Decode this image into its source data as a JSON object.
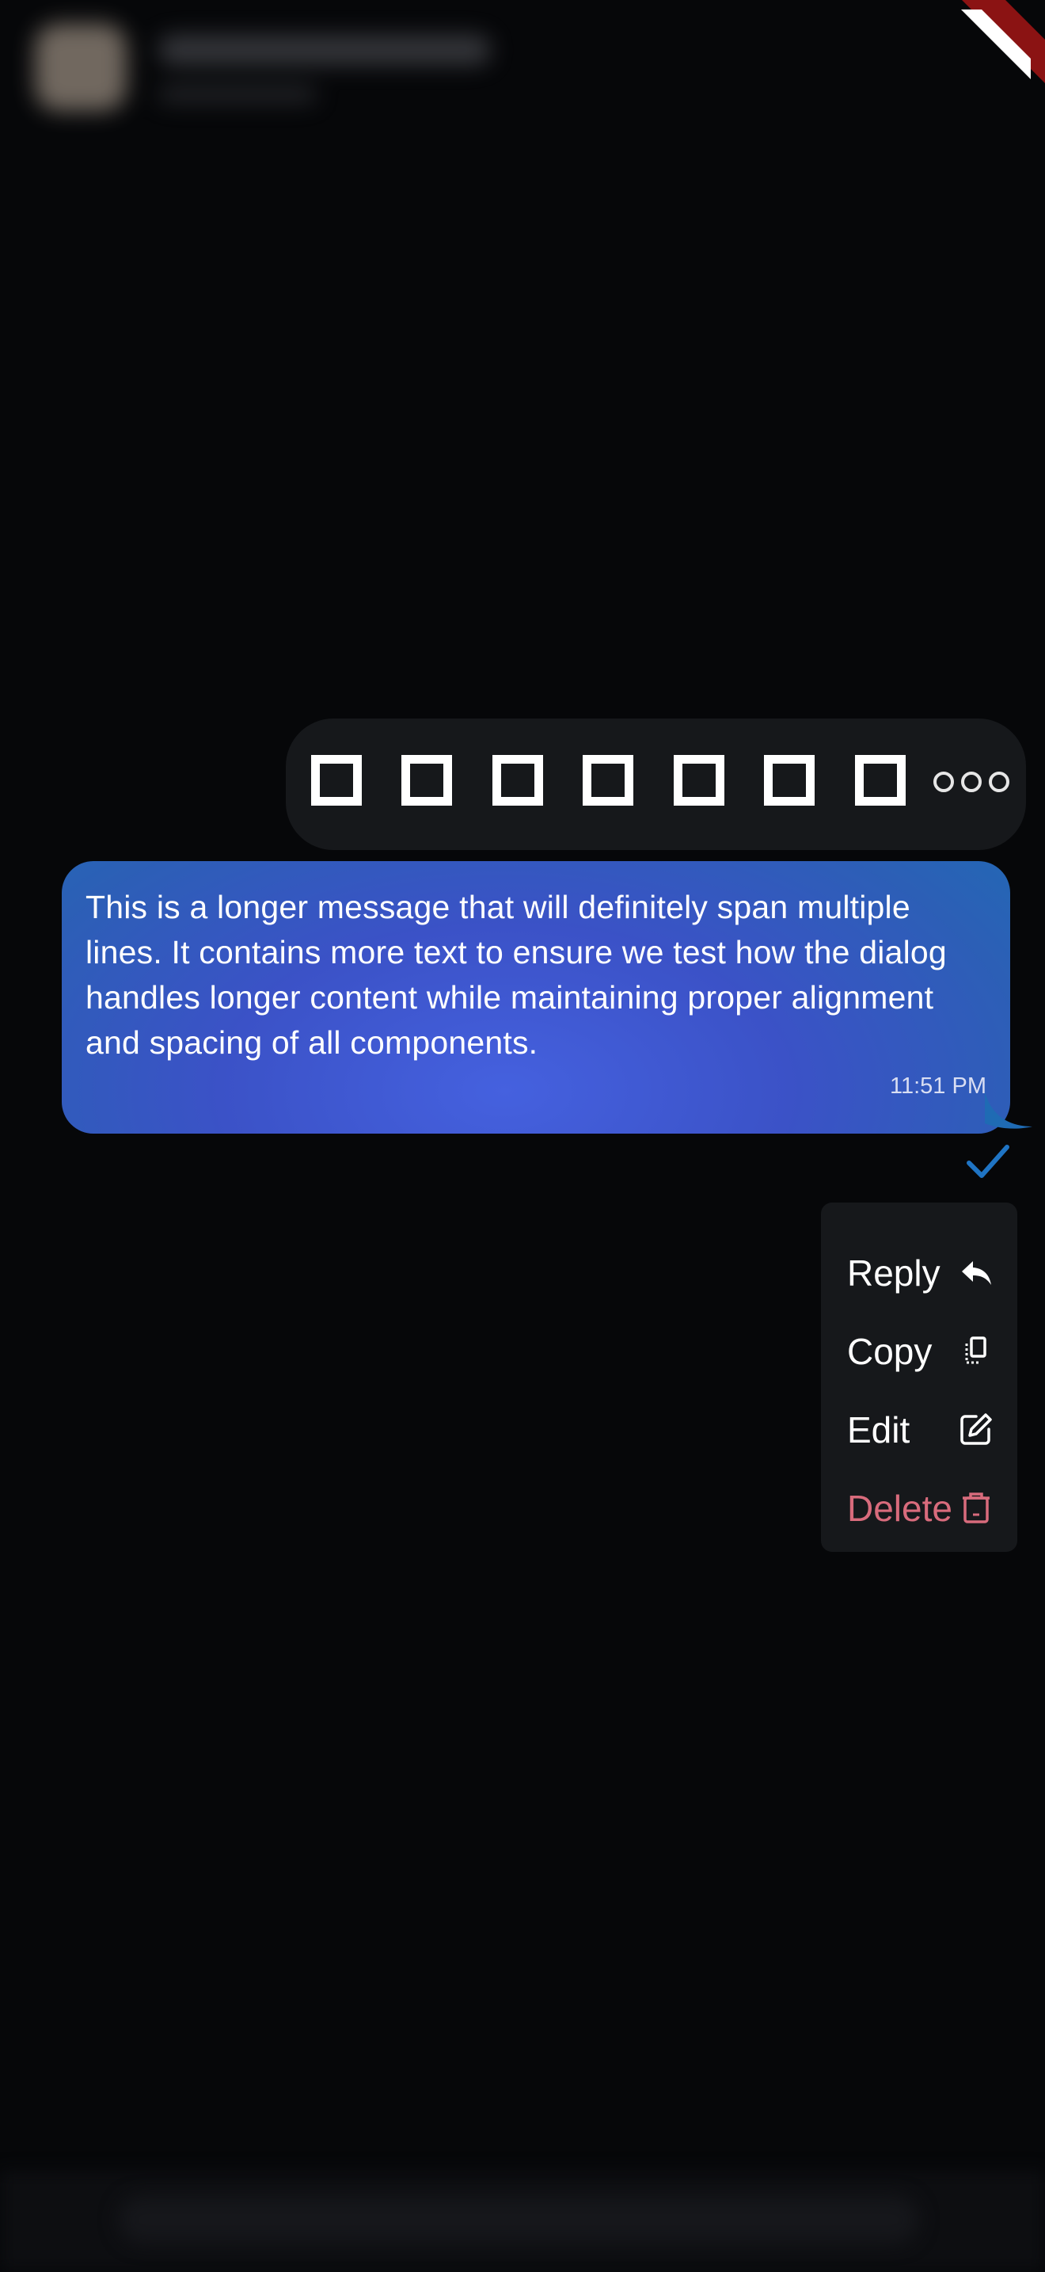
{
  "reactions": {
    "items": [
      "reaction-1",
      "reaction-2",
      "reaction-3",
      "reaction-4",
      "reaction-5",
      "reaction-6",
      "reaction-7"
    ],
    "more_icon": "more-horizontal-icon"
  },
  "message": {
    "text": "This is a longer message that will definitely span multiple lines. It contains more text to ensure we test how the dialog handles longer content while maintaining proper alignment and spacing of all components.",
    "time": "11:51 PM",
    "status_icon": "check-icon",
    "bubble_colors": [
      "#4561df",
      "#1f6bb4"
    ],
    "check_color": "#1f74c4"
  },
  "menu": {
    "items": [
      {
        "label": "Reply",
        "icon": "reply-icon",
        "color": "#ffffff"
      },
      {
        "label": "Copy",
        "icon": "copy-icon",
        "color": "#ffffff"
      },
      {
        "label": "Edit",
        "icon": "edit-icon",
        "color": "#ffffff"
      },
      {
        "label": "Delete",
        "icon": "trash-icon",
        "color": "#d86b7c"
      }
    ]
  },
  "colors": {
    "background": "#060709",
    "panel": "#16181b",
    "danger": "#d86b7c",
    "debug_banner": "#8b1313"
  }
}
